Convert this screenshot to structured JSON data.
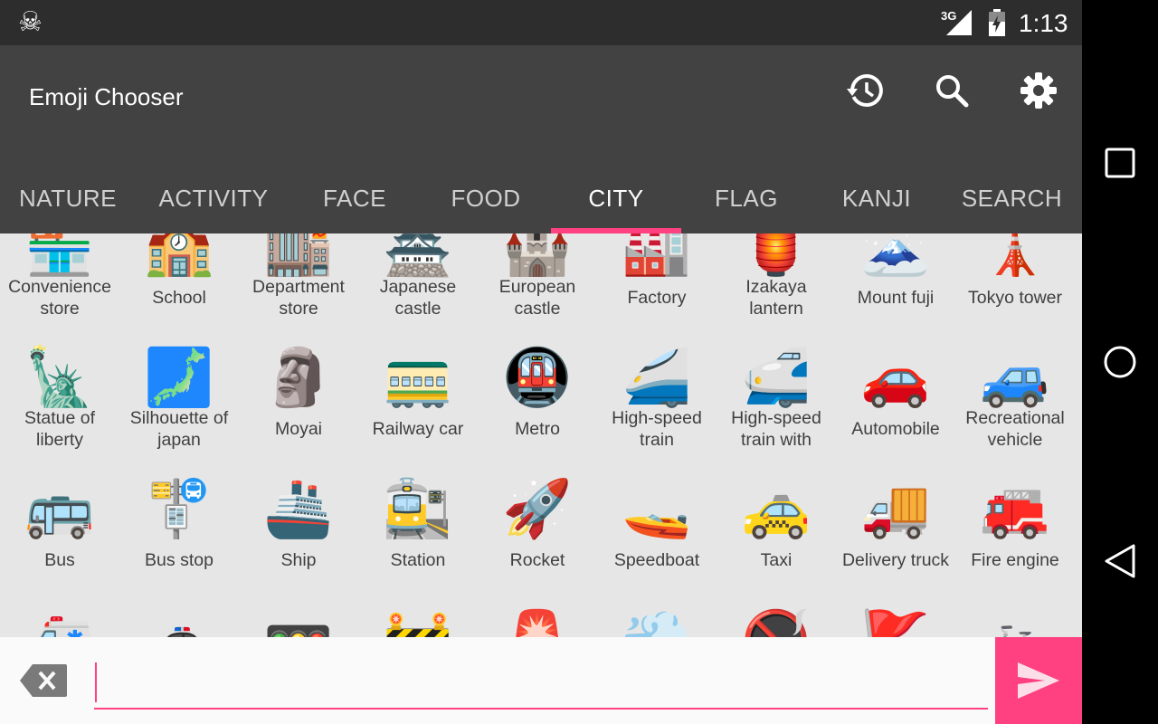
{
  "status_bar": {
    "network": "3G",
    "time": "1:13",
    "notification_icon": "skull-icon"
  },
  "app_bar": {
    "title": "Emoji Chooser",
    "actions": [
      {
        "name": "history-icon"
      },
      {
        "name": "search-icon"
      },
      {
        "name": "settings-icon"
      }
    ]
  },
  "tabs": [
    {
      "label": "NATURE"
    },
    {
      "label": "ACTIVITY"
    },
    {
      "label": "FACE"
    },
    {
      "label": "FOOD"
    },
    {
      "label": "CITY"
    },
    {
      "label": "FLAG"
    },
    {
      "label": "KANJI"
    },
    {
      "label": "SEARCH"
    }
  ],
  "active_tab": "CITY",
  "emoji_rows": [
    [
      {
        "label": "Convenience store",
        "glyph": "🏪"
      },
      {
        "label": "School",
        "glyph": "🏫"
      },
      {
        "label": "Department store",
        "glyph": "🏬"
      },
      {
        "label": "Japanese castle",
        "glyph": "🏯"
      },
      {
        "label": "European castle",
        "glyph": "🏰"
      },
      {
        "label": "Factory",
        "glyph": "🏭"
      },
      {
        "label": "Izakaya lantern",
        "glyph": "🏮"
      },
      {
        "label": "Mount fuji",
        "glyph": "🗻"
      },
      {
        "label": "Tokyo tower",
        "glyph": "🗼"
      }
    ],
    [
      {
        "label": "Statue of liberty",
        "glyph": "🗽"
      },
      {
        "label": "Silhouette of japan",
        "glyph": "🗾"
      },
      {
        "label": "Moyai",
        "glyph": "🗿"
      },
      {
        "label": "Railway car",
        "glyph": "🚃"
      },
      {
        "label": "Metro",
        "glyph": "🚇"
      },
      {
        "label": "High-speed train",
        "glyph": "🚄"
      },
      {
        "label": "High-speed train with",
        "glyph": "🚅"
      },
      {
        "label": "Automobile",
        "glyph": "🚗"
      },
      {
        "label": "Recreational vehicle",
        "glyph": "🚙"
      }
    ],
    [
      {
        "label": "Bus",
        "glyph": "🚌"
      },
      {
        "label": "Bus stop",
        "glyph": "🚏"
      },
      {
        "label": "Ship",
        "glyph": "🚢"
      },
      {
        "label": "Station",
        "glyph": "🚉"
      },
      {
        "label": "Rocket",
        "glyph": "🚀"
      },
      {
        "label": "Speedboat",
        "glyph": "🚤"
      },
      {
        "label": "Taxi",
        "glyph": "🚕"
      },
      {
        "label": "Delivery truck",
        "glyph": "🚚"
      },
      {
        "label": "Fire engine",
        "glyph": "🚒"
      }
    ],
    [
      {
        "label": "",
        "glyph": "🚑"
      },
      {
        "label": "",
        "glyph": "🚓"
      },
      {
        "label": "",
        "glyph": "🚥"
      },
      {
        "label": "",
        "glyph": "🚧"
      },
      {
        "label": "",
        "glyph": "🚨"
      },
      {
        "label": "",
        "glyph": "💨"
      },
      {
        "label": "",
        "glyph": "🚭"
      },
      {
        "label": "",
        "glyph": "🚩"
      },
      {
        "label": "",
        "glyph": "🚲"
      }
    ]
  ],
  "input": {
    "value": "",
    "placeholder": ""
  },
  "bottom": {
    "backspace_icon": "backspace-icon",
    "send_icon": "send-icon"
  },
  "nav_bar": [
    {
      "name": "recents-icon"
    },
    {
      "name": "home-icon"
    },
    {
      "name": "back-icon"
    }
  ],
  "colors": {
    "accent": "#ff4081",
    "app_bar": "#424242",
    "status_bar": "#2d2d2d",
    "grid_bg": "#e6e6e6"
  }
}
